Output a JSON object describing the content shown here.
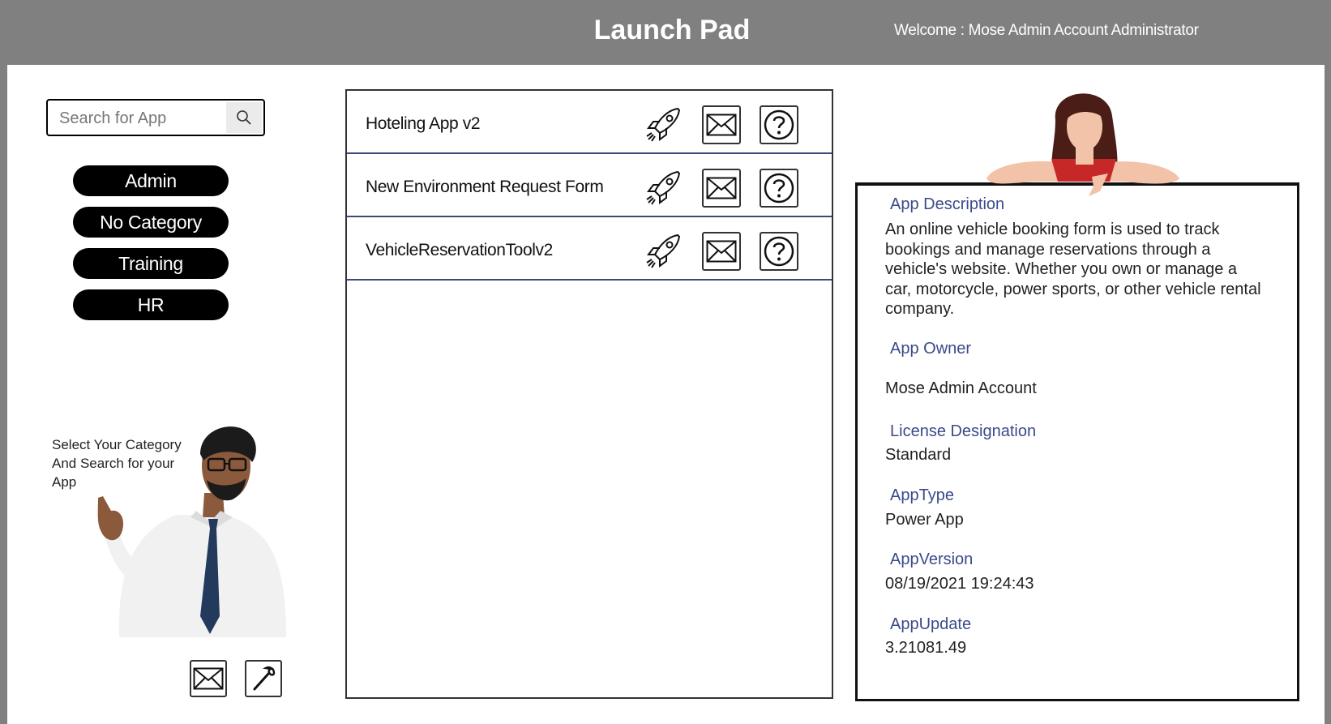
{
  "header": {
    "title": "Launch Pad",
    "welcome": "Welcome : Mose Admin Account Administrator"
  },
  "search": {
    "placeholder": "Search for App",
    "icon": "search-icon"
  },
  "categories": [
    "Admin",
    "No Category",
    "Training",
    "HR"
  ],
  "helper_text": "Select Your Category And Search for your App",
  "bottom_actions": {
    "mail_icon": "mail-icon",
    "settings_icon": "wrench-icon"
  },
  "apps": [
    {
      "name": "Hoteling App v2"
    },
    {
      "name": "New Environment Request Form"
    },
    {
      "name": "VehicleReservationToolv2"
    }
  ],
  "details": {
    "description_label": "App Description",
    "description": "An online vehicle booking form is used to track bookings and manage reservations through a vehicle's website. Whether you own or manage a car, motorcycle, power sports, or other vehicle rental company.",
    "owner_label": "App Owner",
    "owner": "Mose Admin Account",
    "license_label": "License Designation",
    "license": "Standard",
    "type_label": "AppType",
    "type": "Power App",
    "version_label": "AppVersion",
    "version": "08/19/2021 19:24:43",
    "update_label": "AppUpdate",
    "update": "3.21081.49"
  },
  "colors": {
    "header_bg": "#808080",
    "pill_bg": "#000000",
    "label_blue": "#3b4a8a",
    "row_divider": "#3b4a7a"
  }
}
